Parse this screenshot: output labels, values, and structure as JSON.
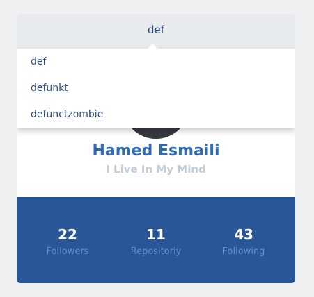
{
  "search": {
    "value": "def"
  },
  "suggestions": [
    {
      "label": "def"
    },
    {
      "label": "defunkt"
    },
    {
      "label": "defunctzombie"
    }
  ],
  "profile": {
    "name": "Hamed Esmaili",
    "tagline": "I Live In My Mind"
  },
  "stats": [
    {
      "value": "22",
      "label": "Followers"
    },
    {
      "value": "11",
      "label": "Repositoriy"
    },
    {
      "value": "43",
      "label": "Following"
    }
  ],
  "colors": {
    "accent": "#2e69b5",
    "stats_background": "#2a5596",
    "stat_label": "#5d92d8",
    "tagline": "#c4cdd6"
  }
}
